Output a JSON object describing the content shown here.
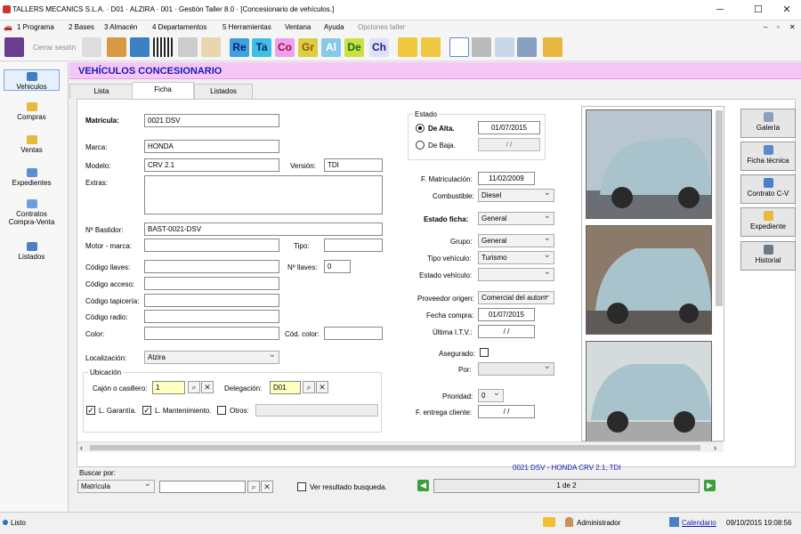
{
  "window": {
    "title": "TALLERS MECANICS S.L.A. · D01 · ALZIRA · 001 · Gestión Taller 8.0 · [Concesionario de vehículos.]",
    "minimize": "─",
    "maximize": "☐",
    "close": "✕"
  },
  "menu": {
    "items": [
      "1 Programa",
      "2 Bases",
      "3 Almacén",
      "4 Departamentos",
      "5 Herramientas",
      "Ventana",
      "Ayuda",
      "Opciones taller"
    ],
    "right_controls": [
      "‒",
      "▫",
      "✕"
    ]
  },
  "toolbar": {
    "close_session": "Cerrar sesión",
    "text_buttons": [
      "Re",
      "Ta",
      "Co",
      "Gr",
      "Al",
      "De",
      "Ch"
    ]
  },
  "sidebar": {
    "items": [
      "Vehiculos",
      "Compras",
      "Ventas",
      "Expedientes",
      "Contratos Compra-Venta",
      "Listados"
    ]
  },
  "header": {
    "title": "VEHÍCULOS CONCESIONARIO"
  },
  "tabs": [
    "Lista",
    "Ficha",
    "Listados"
  ],
  "form": {
    "matricula_label": "Matrícula:",
    "matricula": "0021 DSV",
    "marca_label": "Marca:",
    "marca": "HONDA",
    "modelo_label": "Modelo:",
    "modelo": "CRV 2.1",
    "version_label": "Versión:",
    "version": "TDI",
    "extras_label": "Extras:",
    "extras": "",
    "bastidor_label": "Nº Bastidor:",
    "bastidor": "BAST-0021-DSV",
    "motor_label": "Motor - marca:",
    "motor": "",
    "tipo_label": "Tipo:",
    "tipo": "",
    "llaves_label": "Código llaves:",
    "llaves": "",
    "nllaves_label": "Nº llaves:",
    "nllaves": "0",
    "acceso_label": "Código acceso:",
    "acceso": "",
    "tapiceria_label": "Código tapicería:",
    "tapiceria": "",
    "radio_label": "Código radio:",
    "radio": "",
    "color_label": "Color:",
    "color": "",
    "codcolor_label": "Cód. color:",
    "codcolor": "",
    "localizacion_label": "Localización:",
    "localizacion": "Alzira",
    "ubicacion_label": "Ubicación",
    "cajon_label": "Cajón o casillero:",
    "cajon": "1",
    "delegacion_label": "Delegación:",
    "delegacion": "D01",
    "garantia_label": "L. Garantía.",
    "mantenimiento_label": "L. Mantenimiento.",
    "otros_label": "Otros:",
    "otros": ""
  },
  "estado": {
    "group_label": "Estado",
    "alta_label": "De Alta.",
    "alta_date": "01/07/2015",
    "baja_label": "De Baja.",
    "baja_date": "  /  /",
    "matriculacion_label": "F. Matriculación:",
    "matriculacion": "11/02/2009",
    "combustible_label": "Combustible:",
    "combustible": "Diesel",
    "estado_ficha_label": "Estado ficha:",
    "estado_ficha": "General",
    "grupo_label": "Grupo:",
    "grupo": "General",
    "tipo_vehiculo_label": "Tipo vehículo:",
    "tipo_vehiculo": "Turismo",
    "estado_vehiculo_label": "Estado vehículo:",
    "estado_vehiculo": "",
    "proveedor_label": "Proveedor origen:",
    "proveedor": "Comercial del autom",
    "fecha_compra_label": "Fecha compra:",
    "fecha_compra": "01/07/2015",
    "itv_label": "Última I.T.V.:",
    "itv": "  /  /",
    "asegurado_label": "Asegurado:",
    "por_label": "Por:",
    "por": "",
    "prioridad_label": "Prioridad:",
    "prioridad": "0",
    "entrega_label": "F. entrega cliente:",
    "entrega": "  /  /"
  },
  "right_buttons": [
    "Galería",
    "Ficha técnica",
    "Contrato C-V",
    "Expediente",
    "Historial"
  ],
  "search": {
    "label": "Buscar por:",
    "field": "Matrícula",
    "value": "",
    "show_result_label": "Ver resultado busqueda."
  },
  "record": {
    "summary": "0021 DSV - HONDA CRV 2.1, TDI",
    "position": "1 de 2"
  },
  "status": {
    "left": "Listo",
    "user": "Administrador",
    "calendar": "Calendario",
    "datetime": "09/10/2015 19:08:56"
  },
  "colors": {
    "header_bg": "#f6c6f6",
    "header_text": "#1a1ab5",
    "record_text": "#1a1ab5"
  }
}
